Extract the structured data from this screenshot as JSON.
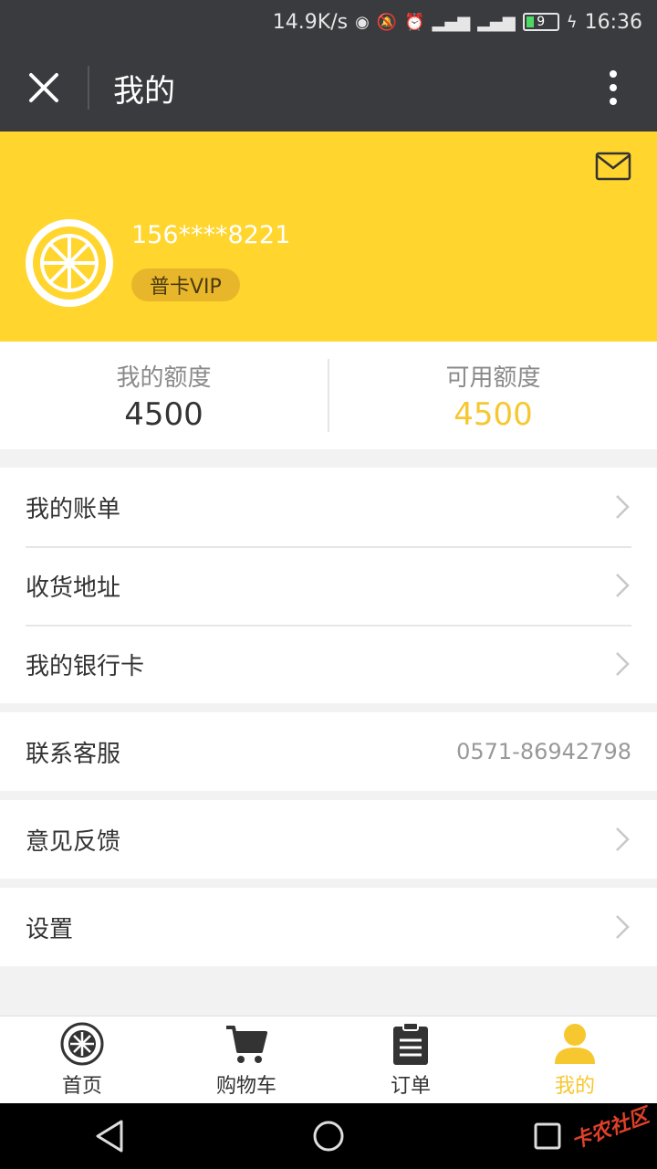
{
  "status": {
    "speed": "14.9K/s",
    "battery": "9",
    "time": "16:36"
  },
  "header": {
    "title": "我的"
  },
  "profile": {
    "phone": "156****8221",
    "vip": "普卡VIP"
  },
  "quota": {
    "mine_label": "我的额度",
    "mine_value": "4500",
    "avail_label": "可用额度",
    "avail_value": "4500"
  },
  "menu": {
    "bill": "我的账单",
    "address": "收货地址",
    "bankcard": "我的银行卡",
    "service": "联系客服",
    "service_phone": "0571-86942798",
    "feedback": "意见反馈",
    "settings": "设置"
  },
  "tabs": {
    "home": "首页",
    "cart": "购物车",
    "orders": "订单",
    "mine": "我的"
  },
  "watermark": "卡农社区",
  "colors": {
    "accent": "#ffd52e",
    "header_bg": "#3a3b3f",
    "active_tab": "#f7c72f"
  }
}
